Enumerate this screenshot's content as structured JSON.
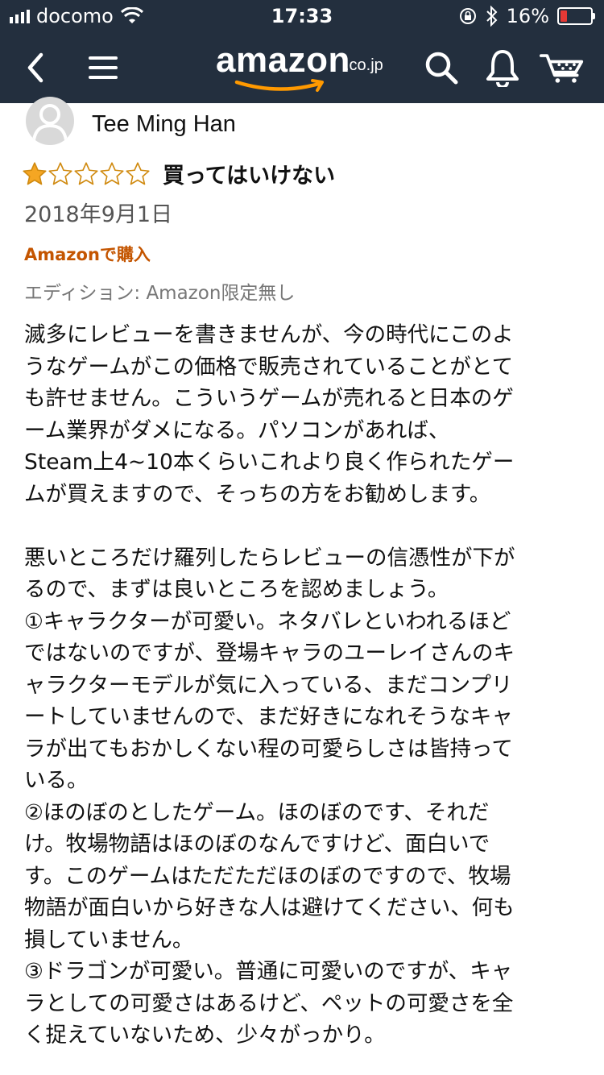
{
  "status_bar": {
    "carrier": "docomo",
    "time": "17:33",
    "battery_percent": "16%",
    "battery_level": 0.16,
    "battery_color": "#e53935"
  },
  "nav": {
    "back_icon": "chevron-left-icon",
    "menu_icon": "hamburger-menu-icon",
    "logo_text": "amazon",
    "logo_tld": ".co.jp",
    "search_icon": "search-icon",
    "notification_icon": "bell-icon",
    "cart_icon": "cart-icon",
    "bar_color": "#232f3e",
    "accent_color": "#ff9900"
  },
  "review": {
    "reviewer_name": "Tee Ming Han",
    "rating": 1,
    "rating_max": 5,
    "title": "買ってはいけない",
    "date": "2018年9月1日",
    "verified_label": "Amazonで購入",
    "edition_label": "エディション: Amazon限定無し",
    "body_lines": [
      "滅多にレビューを書きませんが、今の時代にこのよ",
      "うなゲームがこの価格で販売されていることがとて",
      "も許せません。こういうゲームが売れると日本のゲ",
      "ーム業界がダメになる。パソコンがあれば、",
      "Steam上4~10本くらいこれより良く作られたゲー",
      "ムが買えますので、そっちの方をお勧めします。",
      "",
      "悪いところだけ羅列したらレビューの信憑性が下が",
      "るので、まずは良いところを認めましょう。",
      "①キャラクターが可愛い。ネタバレといわれるほど",
      "ではないのですが、登場キャラのユーレイさんのキ",
      "ャラクターモデルが気に入っている、まだコンプリ",
      "ートしていませんので、まだ好きになれそうなキャ",
      "ラが出てもおかしくない程の可愛らしさは皆持って",
      "いる。",
      "②ほのぼのとしたゲーム。ほのぼのです、それだ",
      "け。牧場物語はほのぼのなんですけど、面白いで",
      "す。このゲームはただただほのぼのですので、牧場",
      "物語が面白いから好きな人は避けてください、何も",
      "損していません。",
      "③ドラゴンが可愛い。普通に可愛いのですが、キャ",
      "ラとしての可愛さはあるけど、ペットの可愛さを全",
      "く捉えていないため、少々がっかり。"
    ]
  }
}
